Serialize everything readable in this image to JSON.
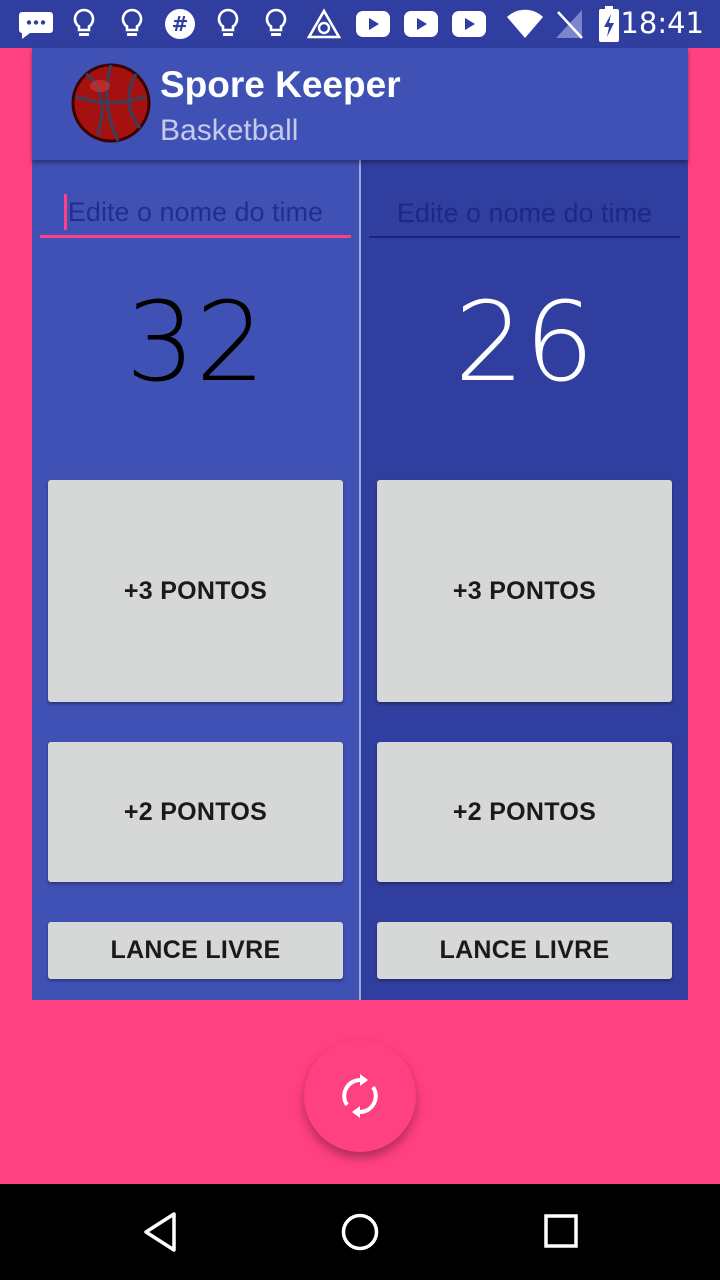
{
  "status_bar": {
    "time": "18:41",
    "icons": [
      "messaging-icon",
      "lightbulb-icon",
      "lightbulb-icon",
      "slack-icon",
      "lightbulb-icon",
      "lightbulb-icon",
      "triangle-app-icon",
      "youtube-icon",
      "youtube-icon",
      "youtube-icon",
      "wifi-icon",
      "no-signal-icon",
      "battery-charging-icon"
    ]
  },
  "app_bar": {
    "title": "Spore Keeper",
    "subtitle": "Basketball"
  },
  "team_a": {
    "name_value": "",
    "name_placeholder": "Edite o nome do time",
    "score": "32",
    "btn_three": "+3 PONTOS",
    "btn_two": "+2 PONTOS",
    "btn_free_throw": "LANCE LIVRE"
  },
  "team_b": {
    "name_value": "",
    "name_placeholder": "Edite o nome do time",
    "score": "26",
    "btn_three": "+3 PONTOS",
    "btn_two": "+2 PONTOS",
    "btn_free_throw": "LANCE LIVRE"
  },
  "fab": {
    "icon": "refresh-icon"
  },
  "nav_bar": {
    "icons": [
      "back-icon",
      "home-icon",
      "recents-icon"
    ]
  },
  "colors": {
    "primary": "#3f51b5",
    "primary_dark": "#303f9f",
    "accent": "#ff4081",
    "button": "#d6d7d7"
  }
}
